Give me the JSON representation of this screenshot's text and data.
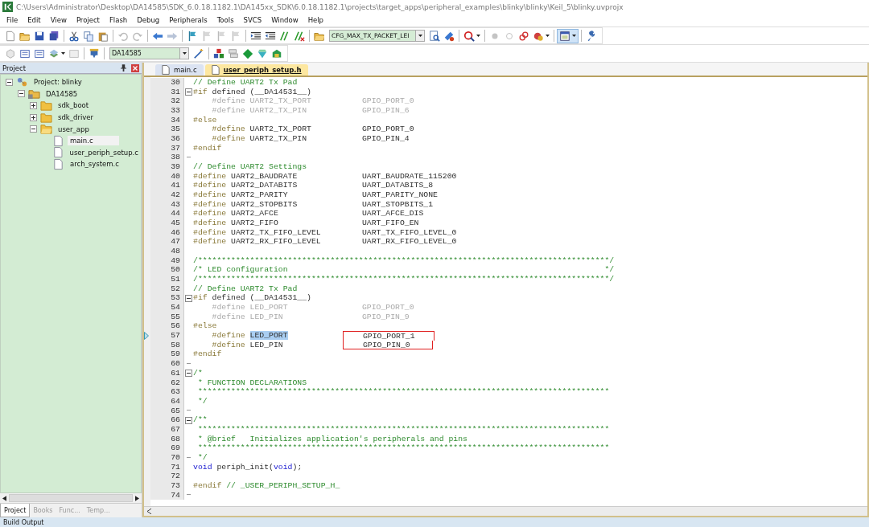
{
  "window": {
    "title": "C:\\Users\\Administrator\\Desktop\\DA14585\\SDK_6.0.18.1182.1\\DA145xx_SDK\\6.0.18.1182.1\\projects\\target_apps\\peripheral_examples\\blinky\\blinky\\Keil_5\\blinky.uvprojx"
  },
  "menu": [
    "File",
    "Edit",
    "View",
    "Project",
    "Flash",
    "Debug",
    "Peripherals",
    "Tools",
    "SVCS",
    "Window",
    "Help"
  ],
  "toolbar": {
    "find_combo": "CFG_MAX_TX_PACKET_LEI",
    "target_combo": "DA14585"
  },
  "project_panel": {
    "title": "Project",
    "tree": [
      {
        "label": "Project: blinky",
        "kind": "project",
        "expanded": true,
        "selected": false,
        "children": [
          {
            "label": "DA14585",
            "kind": "target",
            "expanded": true,
            "selected": false,
            "children": [
              {
                "label": "sdk_boot",
                "kind": "group",
                "expanded": false,
                "selected": false
              },
              {
                "label": "sdk_driver",
                "kind": "group",
                "expanded": false,
                "selected": false
              },
              {
                "label": "user_app",
                "kind": "group",
                "expanded": true,
                "selected": false,
                "children": [
                  {
                    "label": "main.c",
                    "kind": "file",
                    "selected": true
                  },
                  {
                    "label": "user_periph_setup.c",
                    "kind": "file",
                    "selected": false
                  },
                  {
                    "label": "arch_system.c",
                    "kind": "file",
                    "selected": false
                  }
                ]
              }
            ]
          }
        ]
      }
    ],
    "tabs": [
      {
        "label": "Project",
        "selected": true
      },
      {
        "label": "Books",
        "selected": false
      },
      {
        "label": "Func...",
        "selected": false
      },
      {
        "label": "Temp...",
        "selected": false
      }
    ]
  },
  "editor": {
    "tabs": [
      {
        "label": "main.c",
        "selected": false
      },
      {
        "label": "user_periph_setup.h",
        "selected": true
      }
    ],
    "lines": [
      {
        "n": "30",
        "parts": [
          {
            "kind": "comment",
            "t": "// Define UART2 Tx Pad"
          }
        ]
      },
      {
        "n": "31",
        "fold_start": true,
        "parts": [
          {
            "kind": "directive",
            "t": "#if"
          },
          {
            "kind": "text",
            "t": " defined (__DA14531__)"
          }
        ]
      },
      {
        "n": "32",
        "indent": true,
        "inactive": true,
        "parts": [
          {
            "kind": "directive",
            "t": "#define"
          },
          {
            "kind": "text",
            "t": " UART2_TX_PORT"
          }
        ],
        "value": "GPIO_PORT_0"
      },
      {
        "n": "33",
        "indent": true,
        "inactive": true,
        "parts": [
          {
            "kind": "directive",
            "t": "#define"
          },
          {
            "kind": "text",
            "t": " UART2_TX_PIN"
          }
        ],
        "value": "GPIO_PIN_6"
      },
      {
        "n": "34",
        "parts": [
          {
            "kind": "directive",
            "t": "#else"
          }
        ]
      },
      {
        "n": "35",
        "indent": true,
        "parts": [
          {
            "kind": "directive",
            "t": "#define"
          },
          {
            "kind": "text",
            "t": " UART2_TX_PORT"
          }
        ],
        "value": "GPIO_PORT_0"
      },
      {
        "n": "36",
        "indent": true,
        "parts": [
          {
            "kind": "directive",
            "t": "#define"
          },
          {
            "kind": "text",
            "t": " UART2_TX_PIN"
          }
        ],
        "value": "GPIO_PIN_4"
      },
      {
        "n": "37",
        "parts": [
          {
            "kind": "directive",
            "t": "#endif"
          }
        ]
      },
      {
        "n": "38",
        "fold_end": true
      },
      {
        "n": "39",
        "parts": [
          {
            "kind": "comment",
            "t": "// Define UART2 Settings"
          }
        ]
      },
      {
        "n": "40",
        "parts": [
          {
            "kind": "directive",
            "t": "#define"
          },
          {
            "kind": "text",
            "t": " UART2_BAUDRATE"
          }
        ],
        "value": "UART_BAUDRATE_115200"
      },
      {
        "n": "41",
        "parts": [
          {
            "kind": "directive",
            "t": "#define"
          },
          {
            "kind": "text",
            "t": " UART2_DATABITS"
          }
        ],
        "value": "UART_DATABITS_8"
      },
      {
        "n": "42",
        "parts": [
          {
            "kind": "directive",
            "t": "#define"
          },
          {
            "kind": "text",
            "t": " UART2_PARITY"
          }
        ],
        "value": "UART_PARITY_NONE"
      },
      {
        "n": "43",
        "parts": [
          {
            "kind": "directive",
            "t": "#define"
          },
          {
            "kind": "text",
            "t": " UART2_STOPBITS"
          }
        ],
        "value": "UART_STOPBITS_1"
      },
      {
        "n": "44",
        "parts": [
          {
            "kind": "directive",
            "t": "#define"
          },
          {
            "kind": "text",
            "t": " UART2_AFCE"
          }
        ],
        "value": "UART_AFCE_DIS"
      },
      {
        "n": "45",
        "parts": [
          {
            "kind": "directive",
            "t": "#define"
          },
          {
            "kind": "text",
            "t": " UART2_FIFO"
          }
        ],
        "value": "UART_FIFO_EN"
      },
      {
        "n": "46",
        "parts": [
          {
            "kind": "directive",
            "t": "#define"
          },
          {
            "kind": "text",
            "t": " UART2_TX_FIFO_LEVEL"
          }
        ],
        "value": "UART_TX_FIFO_LEVEL_0"
      },
      {
        "n": "47",
        "parts": [
          {
            "kind": "directive",
            "t": "#define"
          },
          {
            "kind": "text",
            "t": " UART2_RX_FIFO_LEVEL"
          }
        ],
        "value": "UART_RX_FIFO_LEVEL_0"
      },
      {
        "n": "48"
      },
      {
        "n": "49",
        "parts": [
          {
            "kind": "comment",
            "t": "/***************************************************************************************/"
          }
        ]
      },
      {
        "n": "50",
        "parts": [
          {
            "kind": "comment",
            "t": "/* LED configuration                                                                   */"
          }
        ]
      },
      {
        "n": "51",
        "parts": [
          {
            "kind": "comment",
            "t": "/***************************************************************************************/"
          }
        ]
      },
      {
        "n": "52",
        "parts": [
          {
            "kind": "comment",
            "t": "// Define UART2 Tx Pad"
          }
        ]
      },
      {
        "n": "53",
        "fold_start": true,
        "parts": [
          {
            "kind": "directive",
            "t": "#if"
          },
          {
            "kind": "text",
            "t": " defined (__DA14531__)"
          }
        ]
      },
      {
        "n": "54",
        "indent": true,
        "inactive": true,
        "parts": [
          {
            "kind": "directive",
            "t": "#define"
          },
          {
            "kind": "text",
            "t": " LED_PORT"
          }
        ],
        "value": "GPIO_PORT_0"
      },
      {
        "n": "55",
        "indent": true,
        "inactive": true,
        "parts": [
          {
            "kind": "directive",
            "t": "#define"
          },
          {
            "kind": "text",
            "t": " LED_PIN"
          }
        ],
        "value": "GPIO_PIN_9"
      },
      {
        "n": "56",
        "parts": [
          {
            "kind": "directive",
            "t": "#else"
          }
        ]
      },
      {
        "n": "57",
        "indent": true,
        "current": true,
        "boxed": true,
        "parts": [
          {
            "kind": "directive",
            "t": "#define "
          },
          {
            "kind": "selection",
            "t": "LED_PORT"
          }
        ],
        "value": "GPIO_PORT_1"
      },
      {
        "n": "58",
        "indent": true,
        "boxed": true,
        "parts": [
          {
            "kind": "directive",
            "t": "#define"
          },
          {
            "kind": "text",
            "t": " LED_PIN"
          }
        ],
        "value": "GPIO_PIN_0"
      },
      {
        "n": "59",
        "parts": [
          {
            "kind": "directive",
            "t": "#endif"
          }
        ]
      },
      {
        "n": "60",
        "fold_end": true
      },
      {
        "n": "61",
        "fold_start": true,
        "parts": [
          {
            "kind": "comment",
            "t": "/*"
          }
        ]
      },
      {
        "n": "62",
        "parts": [
          {
            "kind": "comment",
            "t": " * FUNCTION DECLARATIONS"
          }
        ]
      },
      {
        "n": "63",
        "parts": [
          {
            "kind": "comment",
            "t": " ***************************************************************************************"
          }
        ]
      },
      {
        "n": "64",
        "parts": [
          {
            "kind": "comment",
            "t": " */"
          }
        ]
      },
      {
        "n": "65",
        "fold_end": true
      },
      {
        "n": "66",
        "fold_start": true,
        "parts": [
          {
            "kind": "comment",
            "t": "/**"
          }
        ]
      },
      {
        "n": "67",
        "parts": [
          {
            "kind": "comment",
            "t": " ***************************************************************************************"
          }
        ]
      },
      {
        "n": "68",
        "parts": [
          {
            "kind": "comment",
            "t": " * @brief   Initializes application's peripherals and pins"
          }
        ]
      },
      {
        "n": "69",
        "parts": [
          {
            "kind": "comment",
            "t": " ***************************************************************************************"
          }
        ]
      },
      {
        "n": "70",
        "fold_end": true,
        "parts": [
          {
            "kind": "comment",
            "t": " */"
          }
        ]
      },
      {
        "n": "71",
        "parts": [
          {
            "kind": "keyword",
            "t": "void"
          },
          {
            "kind": "text",
            "t": " periph_init("
          },
          {
            "kind": "keyword",
            "t": "void"
          },
          {
            "kind": "text",
            "t": ");"
          }
        ]
      },
      {
        "n": "72"
      },
      {
        "n": "73",
        "parts": [
          {
            "kind": "directive",
            "t": "#endif"
          },
          {
            "kind": "comment",
            "t": " // _USER_PERIPH_SETUP_H_"
          }
        ]
      },
      {
        "n": "74",
        "fold_end": true
      }
    ]
  },
  "build_output": {
    "title": "Build Output"
  }
}
